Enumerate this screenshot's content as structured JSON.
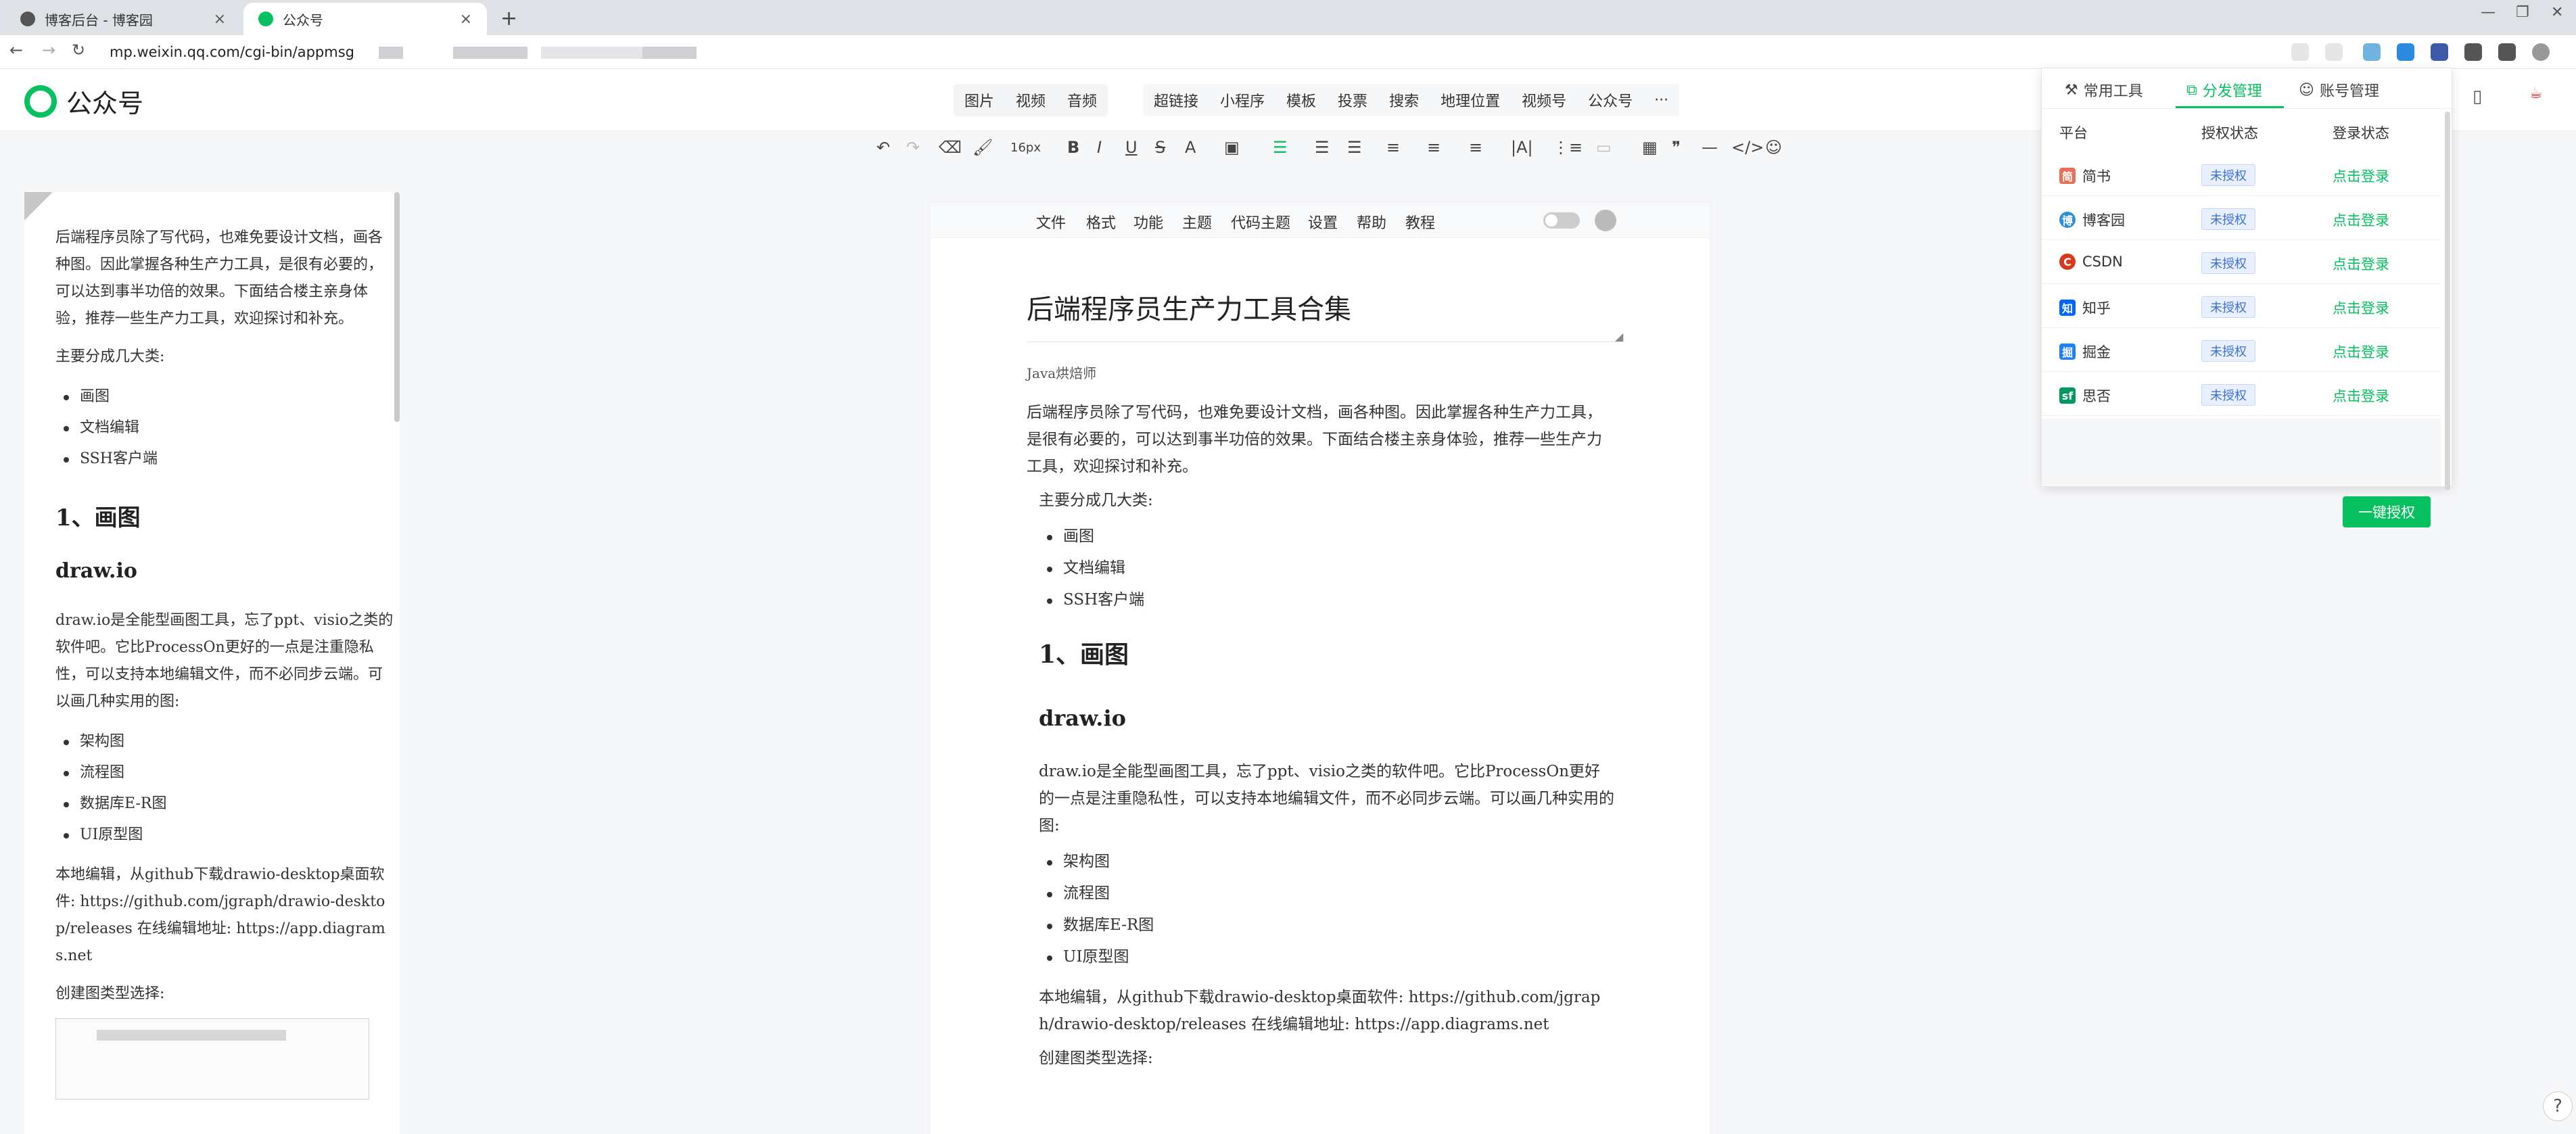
{
  "browser": {
    "tabs": [
      {
        "title": "博客后台 - 博客园",
        "close": "×"
      },
      {
        "title": "公众号",
        "close": "×"
      }
    ],
    "new_tab": "+",
    "url": "mp.weixin.qq.com/cgi-bin/appmsg",
    "nav": {
      "back": "←",
      "forward": "→",
      "reload": "↻"
    }
  },
  "app": {
    "name": "公众号",
    "insert_group1": [
      "图片",
      "视频",
      "音频"
    ],
    "insert_group2": [
      "超链接",
      "小程序",
      "模板",
      "投票",
      "搜索",
      "地理位置",
      "视频号",
      "公众号",
      "···"
    ],
    "font_size": "16px"
  },
  "left_preview": {
    "intro": "后端程序员除了写代码，也难免要设计文档，画各种图。因此掌握各种生产力工具，是很有必要的，可以达到事半功倍的效果。下面结合楼主亲身体验，推荐一些生产力工具，欢迎探讨和补充。",
    "categories_title": "主要分成几大类:",
    "categories": [
      "画图",
      "文档编辑",
      "SSH客户端"
    ],
    "h2": "1、画图",
    "h3": "draw.io",
    "drawio_desc": "draw.io是全能型画图工具，忘了ppt、visio之类的软件吧。它比ProcessOn更好的一点是注重隐私性，可以支持本地编辑文件，而不必同步云端。可以画几种实用的图:",
    "diagram_types": [
      "架构图",
      "流程图",
      "数据库E-R图",
      "UI原型图"
    ],
    "download": "本地编辑，从github下载drawio-desktop桌面软件: https://github.com/jgraph/drawio-desktop/releases 在线编辑地址: https://app.diagrams.net",
    "choose_type": "创建图类型选择:"
  },
  "editor": {
    "menu": [
      "文件",
      "格式",
      "功能",
      "主题",
      "代码主题",
      "设置",
      "帮助",
      "教程"
    ],
    "title": "后端程序员生产力工具合集",
    "author": "Java烘焙师",
    "intro": "后端程序员除了写代码，也难免要设计文档，画各种图。因此掌握各种生产力工具，是很有必要的，可以达到事半功倍的效果。下面结合楼主亲身体验，推荐一些生产力工具，欢迎探讨和补充。",
    "categories_title": "主要分成几大类:",
    "categories": [
      "画图",
      "文档编辑",
      "SSH客户端"
    ],
    "h2": "1、画图",
    "h3": "draw.io",
    "drawio_desc": "draw.io是全能型画图工具，忘了ppt、visio之类的软件吧。它比ProcessOn更好的一点是注重隐私性，可以支持本地编辑文件，而不必同步云端。可以画几种实用的图:",
    "diagram_types": [
      "架构图",
      "流程图",
      "数据库E-R图",
      "UI原型图"
    ],
    "download": "本地编辑，从github下载drawio-desktop桌面软件: https://github.com/jgraph/drawio-desktop/releases 在线编辑地址: https://app.diagrams.net",
    "choose_type": "创建图类型选择:"
  },
  "popup": {
    "tabs": [
      "常用工具",
      "分发管理",
      "账号管理"
    ],
    "headers": [
      "平台",
      "授权状态",
      "登录状态"
    ],
    "rows": [
      {
        "platform": "简书",
        "icon_text": "简",
        "color": "#ea6f5a",
        "auth": "未授权",
        "login": "点击登录"
      },
      {
        "platform": "博客园",
        "icon_text": "博",
        "color": "#2f8fd6",
        "auth": "未授权",
        "login": "点击登录"
      },
      {
        "platform": "CSDN",
        "icon_text": "C",
        "color": "#d9381e",
        "auth": "未授权",
        "login": "点击登录"
      },
      {
        "platform": "知乎",
        "icon_text": "知",
        "color": "#0066ff",
        "auth": "未授权",
        "login": "点击登录"
      },
      {
        "platform": "掘金",
        "icon_text": "掘",
        "color": "#1e80ff",
        "auth": "未授权",
        "login": "点击登录"
      },
      {
        "platform": "思否",
        "icon_text": "sf",
        "color": "#009a61",
        "auth": "未授权",
        "login": "点击登录"
      }
    ],
    "one_click": "一键授权"
  },
  "colors": {
    "brand_green": "#07c160",
    "auth_blue": "#3b6fd8"
  }
}
